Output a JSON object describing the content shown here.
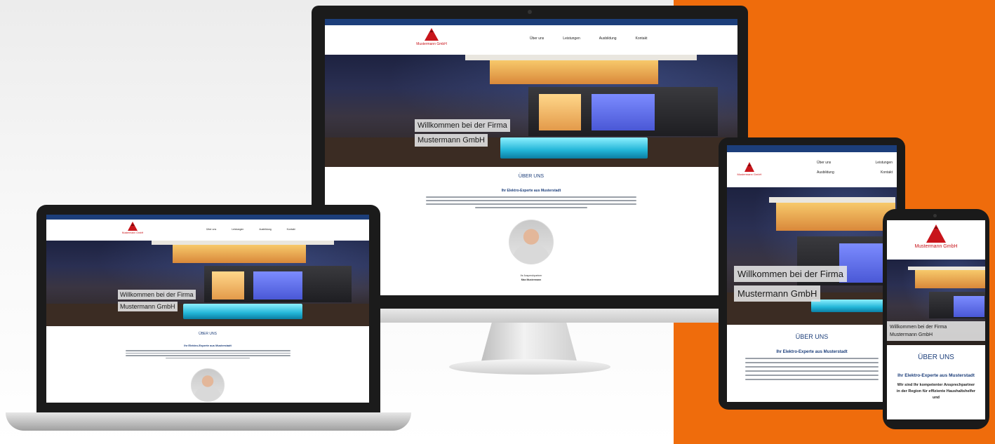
{
  "brand": {
    "name": "Mustermann GmbH",
    "accent": "#c8151b",
    "topbar_color": "#1c3e7a",
    "background_accent": "#ef6c0c"
  },
  "nav": {
    "items": [
      "Über uns",
      "Leistungen",
      "Ausbildung",
      "Kontakt"
    ]
  },
  "hero": {
    "line1": "Willkommen bei der Firma",
    "line2": "Mustermann GmbH"
  },
  "about": {
    "heading": "ÜBER UNS",
    "subheading": "Ihr Elektro-Experte aus Musterstadt",
    "phone_paragraph": "Wir sind Ihr kompetenter Ansprechpartner in der Region für effiziente Haushaltshelfer und"
  },
  "contact_person": {
    "role": "Ihr Ansprechpartner",
    "name": "Max Mustermann"
  }
}
